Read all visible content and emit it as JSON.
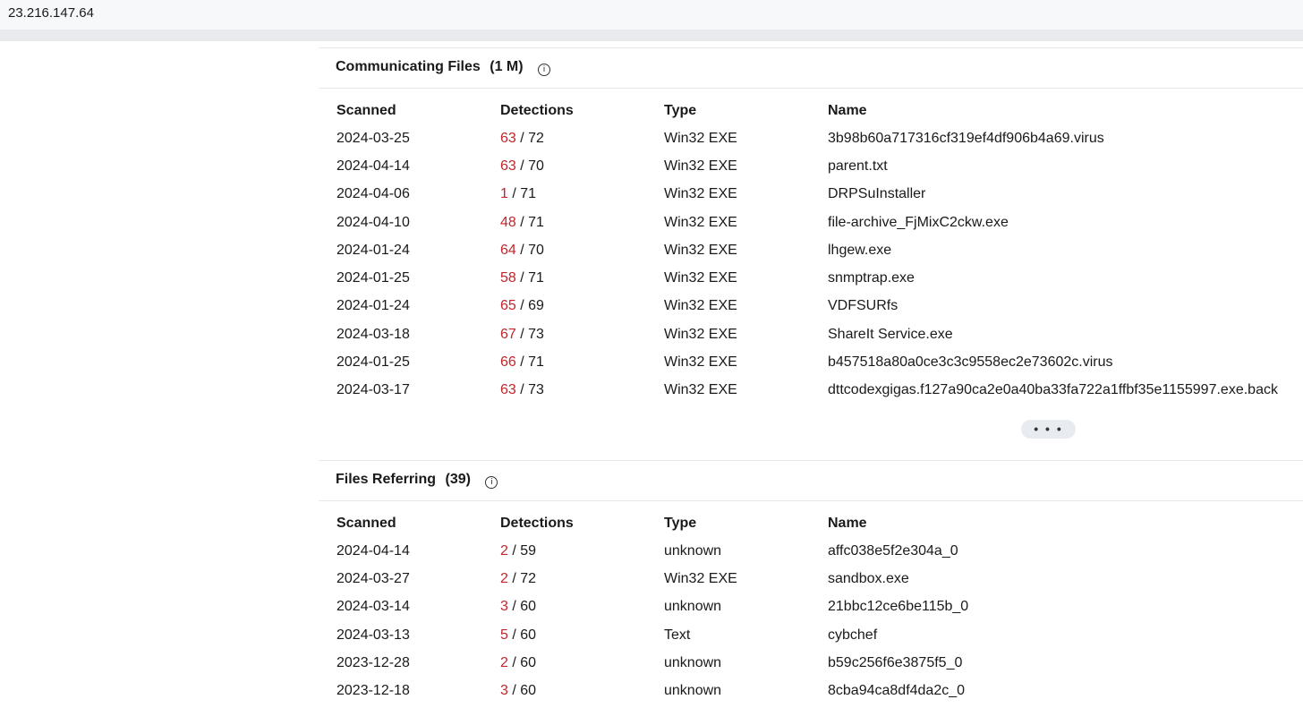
{
  "browser": {
    "address": "23.216.147.64"
  },
  "communicating": {
    "title": "Communicating Files",
    "count": "(1 M)",
    "headers": {
      "scanned": "Scanned",
      "detections": "Detections",
      "type": "Type",
      "name": "Name"
    },
    "rows": [
      {
        "scanned": "2024-03-25",
        "positives": "63",
        "total": "/ 72",
        "type": "Win32 EXE",
        "name": "3b98b60a717316cf319ef4df906b4a69.virus"
      },
      {
        "scanned": "2024-04-14",
        "positives": "63",
        "total": "/ 70",
        "type": "Win32 EXE",
        "name": "parent.txt"
      },
      {
        "scanned": "2024-04-06",
        "positives": "1",
        "total": "/ 71",
        "type": "Win32 EXE",
        "name": "DRPSuInstaller"
      },
      {
        "scanned": "2024-04-10",
        "positives": "48",
        "total": "/ 71",
        "type": "Win32 EXE",
        "name": "file-archive_FjMixC2ckw.exe"
      },
      {
        "scanned": "2024-01-24",
        "positives": "64",
        "total": "/ 70",
        "type": "Win32 EXE",
        "name": "lhgew.exe"
      },
      {
        "scanned": "2024-01-25",
        "positives": "58",
        "total": "/ 71",
        "type": "Win32 EXE",
        "name": "snmptrap.exe"
      },
      {
        "scanned": "2024-01-24",
        "positives": "65",
        "total": "/ 69",
        "type": "Win32 EXE",
        "name": "VDFSURfs"
      },
      {
        "scanned": "2024-03-18",
        "positives": "67",
        "total": "/ 73",
        "type": "Win32 EXE",
        "name": "ShareIt Service.exe"
      },
      {
        "scanned": "2024-01-25",
        "positives": "66",
        "total": "/ 71",
        "type": "Win32 EXE",
        "name": "b457518a80a0ce3c3c9558ec2e73602c.virus"
      },
      {
        "scanned": "2024-03-17",
        "positives": "63",
        "total": "/ 73",
        "type": "Win32 EXE",
        "name": "dttcodexgigas.f127a90ca2e0a40ba33fa722a1ffbf35e1155997.exe.back"
      }
    ],
    "more_label": "• • •"
  },
  "referring": {
    "title": "Files Referring",
    "count": "(39)",
    "headers": {
      "scanned": "Scanned",
      "detections": "Detections",
      "type": "Type",
      "name": "Name"
    },
    "rows": [
      {
        "scanned": "2024-04-14",
        "positives": "2",
        "total": "/ 59",
        "type": "unknown",
        "name": "affc038e5f2e304a_0"
      },
      {
        "scanned": "2024-03-27",
        "positives": "2",
        "total": "/ 72",
        "type": "Win32 EXE",
        "name": "sandbox.exe"
      },
      {
        "scanned": "2024-03-14",
        "positives": "3",
        "total": "/ 60",
        "type": "unknown",
        "name": "21bbc12ce6be115b_0"
      },
      {
        "scanned": "2024-03-13",
        "positives": "5",
        "total": "/ 60",
        "type": "Text",
        "name": "cybchef"
      },
      {
        "scanned": "2023-12-28",
        "positives": "2",
        "total": "/ 60",
        "type": "unknown",
        "name": "b59c256f6e3875f5_0"
      },
      {
        "scanned": "2023-12-18",
        "positives": "3",
        "total": "/ 60",
        "type": "unknown",
        "name": "8cba94ca8df4da2c_0"
      }
    ]
  },
  "colors": {
    "detection_positive": "#c0262d"
  },
  "icons": {
    "info": "info-circle-icon",
    "more": "ellipsis-icon"
  }
}
